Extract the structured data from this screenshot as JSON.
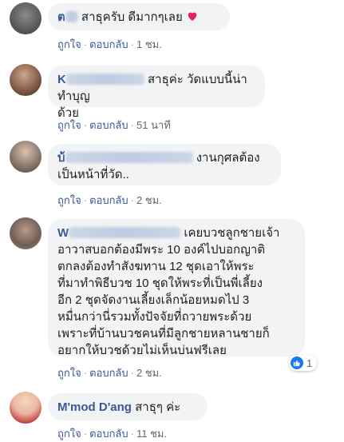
{
  "actions": {
    "like": "ถูกใจ",
    "reply": "ตอบกลับ",
    "sep": "·"
  },
  "comments": [
    {
      "name_visible": "ต",
      "text": "สาธุครับ ดีมากๆเลย",
      "emoji": "heart-emoji",
      "time": "1 ชม."
    },
    {
      "name_visible": "K",
      "text_line1": "สาธุค่ะ วัดแบบนี้น่าทำบุญ",
      "text_line2": "ด้วย",
      "time": "51 นาที"
    },
    {
      "name_visible": "บ้",
      "text_line1": "งานกุศลต้อง",
      "text_line2": "เป็นหน้าที่วัด..",
      "time": "2 ชม."
    },
    {
      "name_visible": "W",
      "text_line1": "เคยบวชลูกชายเจ้า",
      "lines": [
        "อาวาสบอกต้องมีพระ 10 องค์ไปบอกญาติ",
        "ตกลงต้องทำสังฆทาน 12 ชุดเอาให้พระ",
        "ที่มาทำพิธีบวช 10 ชุดให้พระที่เป็นพี่เลี้ยง",
        "อีก 2 ชุดจัดงานเลี้ยงเล็กน้อยหมดไป 3",
        "หมื่นกว่านี่รวมทั้งปัจจัยที่ถวายพระด้วย",
        "เพราะที่บ้านบวชคนที่มีลูกชายหลานชายก็",
        "อยากให้บวชด้วยไม่เห็นบ่นฟรีเลย"
      ],
      "reaction_count": "1",
      "time": "2 ชม."
    },
    {
      "name": "M'mod D'ang",
      "text": "สาธุๆ ค่ะ",
      "time": "11 ชม."
    }
  ],
  "colors": {
    "bubble": "#f2f3f5",
    "name": "#385898",
    "like_blue": "#1877f2",
    "heart": "#e0245e"
  }
}
